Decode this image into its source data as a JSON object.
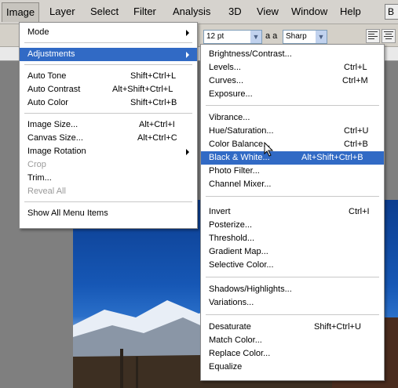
{
  "menubar": {
    "items": [
      "Image",
      "Layer",
      "Select",
      "Filter",
      "Analysis",
      "3D",
      "View",
      "Window",
      "Help"
    ],
    "right_button": "B"
  },
  "options_bar": {
    "font_size": "12 pt",
    "aa_label": "a a",
    "antialias": "Sharp"
  },
  "image_menu": {
    "items": [
      {
        "label": "Mode",
        "shortcut": ""
      },
      {
        "label": "Adjustments",
        "shortcut": ""
      },
      {
        "label": "Auto Tone",
        "shortcut": "Shift+Ctrl+L"
      },
      {
        "label": "Auto Contrast",
        "shortcut": "Alt+Shift+Ctrl+L"
      },
      {
        "label": "Auto Color",
        "shortcut": "Shift+Ctrl+B"
      },
      {
        "label": "Image Size...",
        "shortcut": "Alt+Ctrl+I"
      },
      {
        "label": "Canvas Size...",
        "shortcut": "Alt+Ctrl+C"
      },
      {
        "label": "Image Rotation",
        "shortcut": ""
      },
      {
        "label": "Crop",
        "shortcut": ""
      },
      {
        "label": "Trim...",
        "shortcut": ""
      },
      {
        "label": "Reveal All",
        "shortcut": ""
      },
      {
        "label": "Show All Menu Items",
        "shortcut": ""
      }
    ]
  },
  "adjustments_menu": {
    "items": [
      {
        "label": "Brightness/Contrast...",
        "shortcut": ""
      },
      {
        "label": "Levels...",
        "shortcut": "Ctrl+L"
      },
      {
        "label": "Curves...",
        "shortcut": "Ctrl+M"
      },
      {
        "label": "Exposure...",
        "shortcut": ""
      },
      {
        "label": "Vibrance...",
        "shortcut": ""
      },
      {
        "label": "Hue/Saturation...",
        "shortcut": "Ctrl+U"
      },
      {
        "label": "Color Balance...",
        "shortcut": "Ctrl+B"
      },
      {
        "label": "Black & White...",
        "shortcut": "Alt+Shift+Ctrl+B"
      },
      {
        "label": "Photo Filter...",
        "shortcut": ""
      },
      {
        "label": "Channel Mixer...",
        "shortcut": ""
      },
      {
        "label": "Invert",
        "shortcut": "Ctrl+I"
      },
      {
        "label": "Posterize...",
        "shortcut": ""
      },
      {
        "label": "Threshold...",
        "shortcut": ""
      },
      {
        "label": "Gradient Map...",
        "shortcut": ""
      },
      {
        "label": "Selective Color...",
        "shortcut": ""
      },
      {
        "label": "Shadows/Highlights...",
        "shortcut": ""
      },
      {
        "label": "Variations...",
        "shortcut": ""
      },
      {
        "label": "Desaturate",
        "shortcut": "Shift+Ctrl+U"
      },
      {
        "label": "Match Color...",
        "shortcut": ""
      },
      {
        "label": "Replace Color...",
        "shortcut": ""
      },
      {
        "label": "Equalize",
        "shortcut": ""
      }
    ]
  },
  "colors": {
    "highlight": "#316ac5",
    "menu_bg": "#ffffff",
    "disabled_text": "#9a9a9a"
  }
}
